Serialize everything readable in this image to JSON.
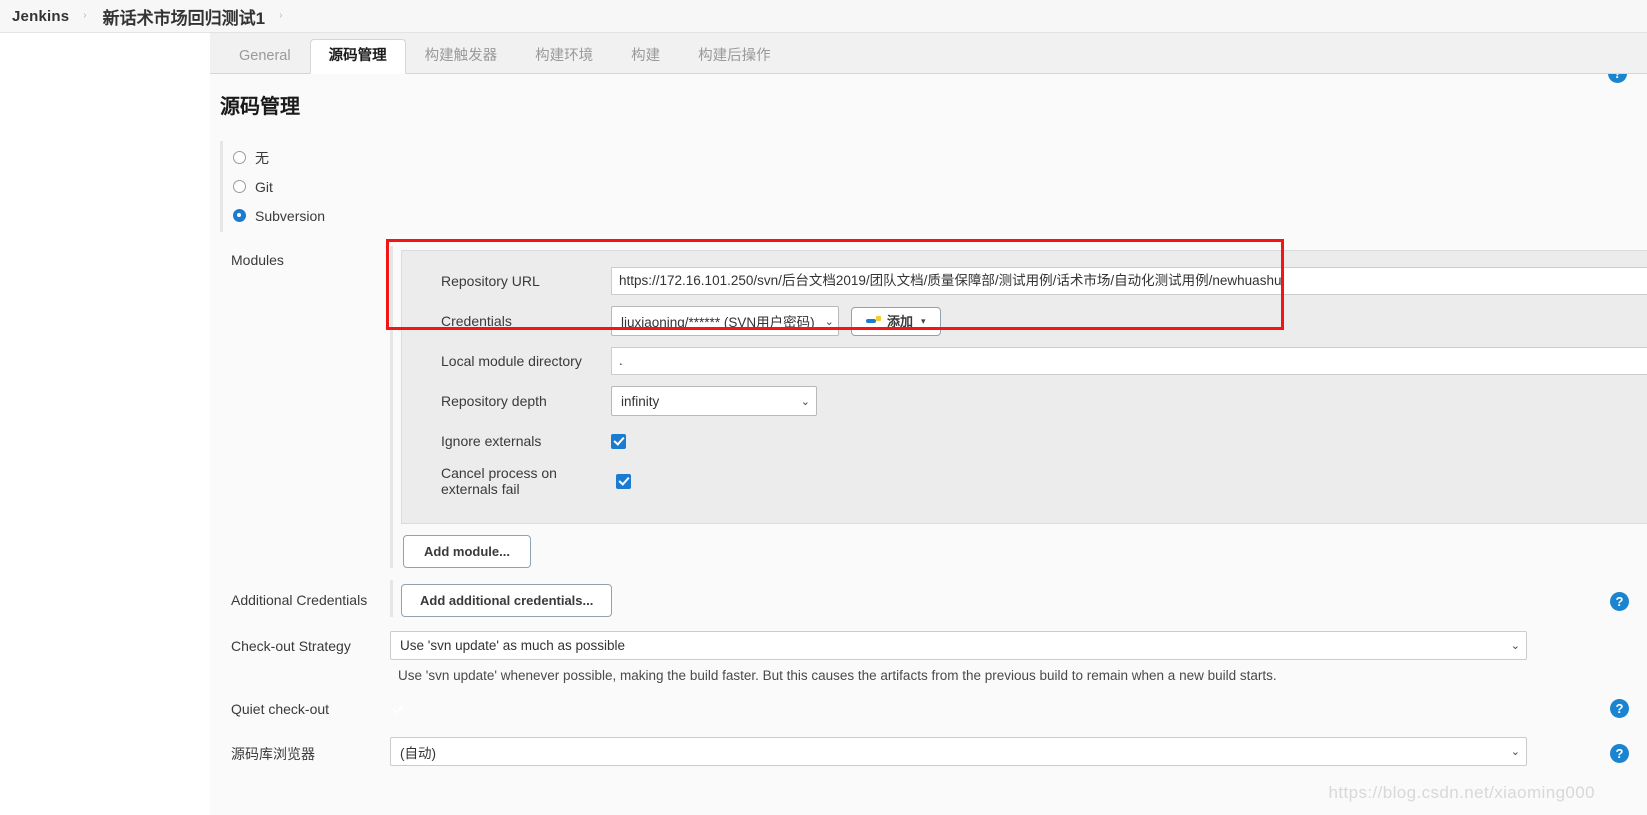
{
  "breadcrumb": {
    "app": "Jenkins",
    "separator": "›",
    "project": "新话术市场回归测试1"
  },
  "tabs": [
    {
      "label": "General",
      "active": false
    },
    {
      "label": "源码管理",
      "active": true
    },
    {
      "label": "构建触发器",
      "active": false
    },
    {
      "label": "构建环境",
      "active": false
    },
    {
      "label": "构建",
      "active": false
    },
    {
      "label": "构建后操作",
      "active": false
    }
  ],
  "section": {
    "title": "源码管理"
  },
  "scm_options": [
    {
      "label": "无",
      "checked": false
    },
    {
      "label": "Git",
      "checked": false
    },
    {
      "label": "Subversion",
      "checked": true
    }
  ],
  "modules": {
    "label": "Modules",
    "repository_url": {
      "label": "Repository URL",
      "value": "https://172.16.101.250/svn/后台文档2019/团队文档/质量保障部/测试用例/话术市场/自动化测试用例/newhuashu"
    },
    "credentials": {
      "label": "Credentials",
      "value": "liuxiaoning/****** (SVN用户密码)",
      "add_button": "添加"
    },
    "local_module_directory": {
      "label": "Local module directory",
      "value": "."
    },
    "repository_depth": {
      "label": "Repository depth",
      "value": "infinity"
    },
    "ignore_externals": {
      "label": "Ignore externals",
      "checked": true
    },
    "cancel_process_on_externals_fail": {
      "label": "Cancel process on externals fail",
      "checked": true
    },
    "add_module_button": "Add module..."
  },
  "additional_credentials": {
    "label": "Additional Credentials",
    "button": "Add additional credentials..."
  },
  "checkout_strategy": {
    "label": "Check-out Strategy",
    "value": "Use 'svn update' as much as possible",
    "description": "Use 'svn update' whenever possible, making the build faster. But this causes the artifacts from the previous build to remain when a new build starts."
  },
  "quiet_checkout": {
    "label": "Quiet check-out",
    "checked": true
  },
  "repository_browser": {
    "label": "源码库浏览器",
    "value": "(自动)"
  },
  "help_icon_glyph": "?",
  "caret_glyph": "⌄",
  "triangle_glyph": "▾",
  "watermark": "https://blog.csdn.net/xiaoming000",
  "colors": {
    "accent": "#1b7bd0",
    "highlight": "#f41414",
    "help": "#1b84d0"
  }
}
